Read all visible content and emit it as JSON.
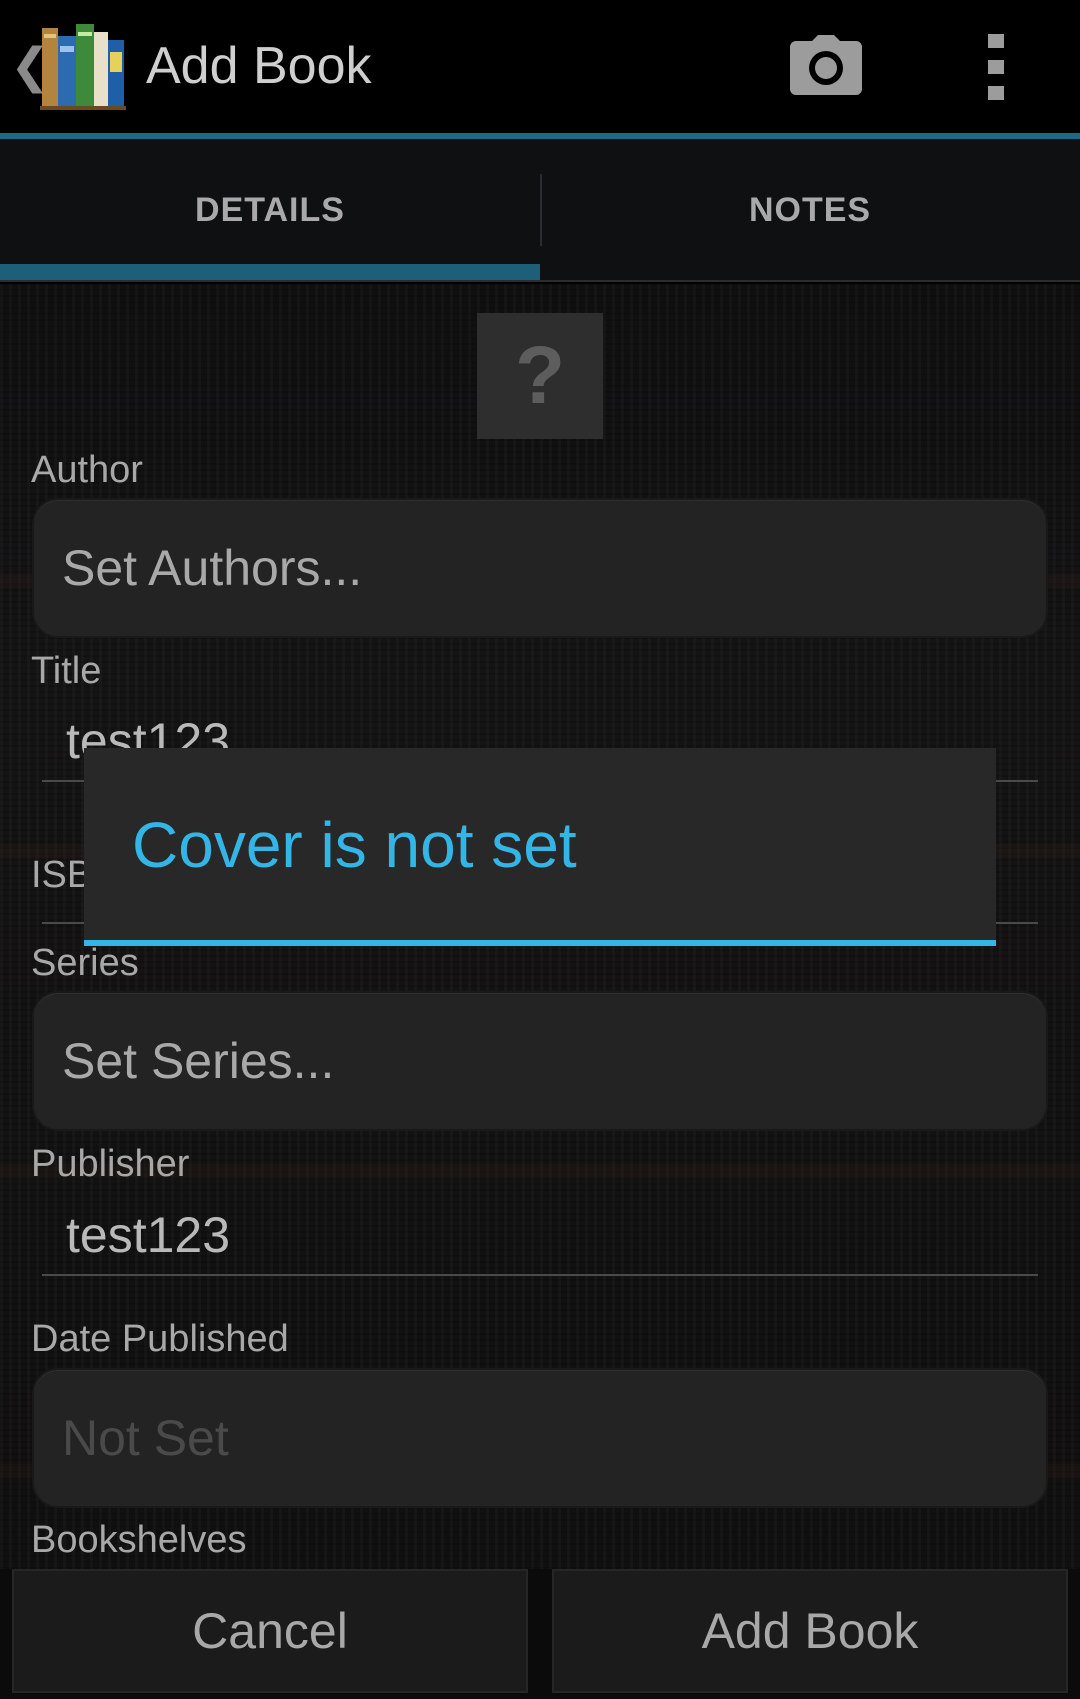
{
  "action_bar": {
    "back_glyph": "❮",
    "title": "Add Book",
    "icons": {
      "app": "bookshelf-app-icon",
      "camera": "camera-icon",
      "overflow": "overflow-menu-icon"
    }
  },
  "tabs": [
    {
      "label": "DETAILS",
      "selected": true
    },
    {
      "label": "NOTES",
      "selected": false
    }
  ],
  "cover": {
    "placeholder": "?"
  },
  "form": {
    "author_label": "Author",
    "author_value": "Set Authors...",
    "title_label": "Title",
    "title_value": "test123",
    "isbn_label": "ISBN",
    "series_label": "Series",
    "series_value": "Set Series...",
    "publisher_label": "Publisher",
    "publisher_value": "test123",
    "date_label": "Date Published",
    "date_value": "Not Set",
    "bookshelves_label": "Bookshelves"
  },
  "buttons": {
    "cancel": "Cancel",
    "add": "Add Book"
  },
  "dialog": {
    "title": "Cover is not set"
  },
  "colors": {
    "accent": "#33b5e5",
    "tab_indicator": "#1d5f78",
    "action_bar_rule": "#1d6a86"
  }
}
